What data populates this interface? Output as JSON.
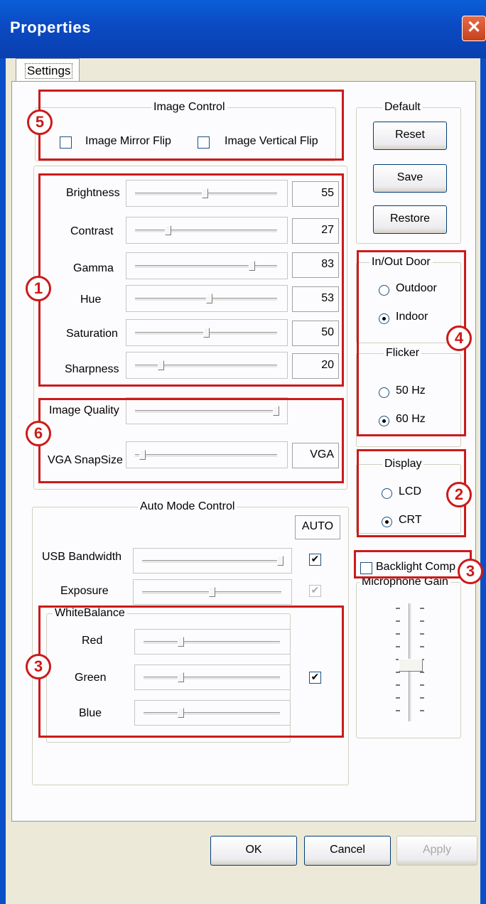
{
  "window": {
    "title": "Properties",
    "close_symbol": "✕"
  },
  "tabs": [
    {
      "label": "Settings",
      "selected": true
    }
  ],
  "image_control": {
    "label": "Image Control",
    "mirror_flip": {
      "label": "Image Mirror Flip",
      "checked": false
    },
    "vertical_flip": {
      "label": "Image Vertical Flip",
      "checked": false
    }
  },
  "adjust": [
    {
      "label": "Brightness",
      "value": "55"
    },
    {
      "label": "Contrast",
      "value": "27"
    },
    {
      "label": "Gamma",
      "value": "83"
    },
    {
      "label": "Hue",
      "value": "53"
    },
    {
      "label": "Saturation",
      "value": "50"
    },
    {
      "label": "Sharpness",
      "value": "20"
    }
  ],
  "image_quality": {
    "label": "Image Quality",
    "level": 1.0
  },
  "vga_snapsize": {
    "label": "VGA SnapSize",
    "value": "VGA",
    "level": 0.0
  },
  "auto_mode": {
    "label": "Auto Mode Control",
    "auto_header": "AUTO",
    "usb_bandwidth": {
      "label": "USB Bandwidth",
      "level": 1.0,
      "auto": true,
      "check": "✔"
    },
    "exposure": {
      "label": "Exposure",
      "level": 0.5,
      "auto": true,
      "disabled": true,
      "check": "✔"
    },
    "white_balance": {
      "label": "WhiteBalance",
      "red": {
        "label": "Red",
        "level": 0.3
      },
      "green": {
        "label": "Green",
        "level": 0.3
      },
      "blue": {
        "label": "Blue",
        "level": 0.3
      },
      "auto": true,
      "check": "✔"
    }
  },
  "default_group": {
    "label": "Default",
    "reset": "Reset",
    "save": "Save",
    "restore": "Restore"
  },
  "inout_door": {
    "label": "In/Out Door",
    "outdoor": {
      "label": "Outdoor",
      "selected": false
    },
    "indoor": {
      "label": "Indoor",
      "selected": true
    }
  },
  "flicker": {
    "label": "Flicker",
    "hz50": {
      "label": "50 Hz",
      "selected": false
    },
    "hz60": {
      "label": "60 Hz",
      "selected": true
    }
  },
  "display": {
    "label": "Display",
    "lcd": {
      "label": "LCD",
      "selected": false
    },
    "crt": {
      "label": "CRT",
      "selected": true
    }
  },
  "backlight": {
    "label": "Backlight Comp",
    "checked": false
  },
  "microphone": {
    "label": "Microphone Gain",
    "level": 0.55
  },
  "markers": [
    "1",
    "2",
    "3",
    "3",
    "4",
    "5",
    "6"
  ],
  "footer": {
    "ok": "OK",
    "cancel": "Cancel",
    "apply": "Apply"
  },
  "colors": {
    "titlebar": "#0b4bc4",
    "annotation_red": "#cc1a1a",
    "dialog_bg": "#ece9d8"
  }
}
